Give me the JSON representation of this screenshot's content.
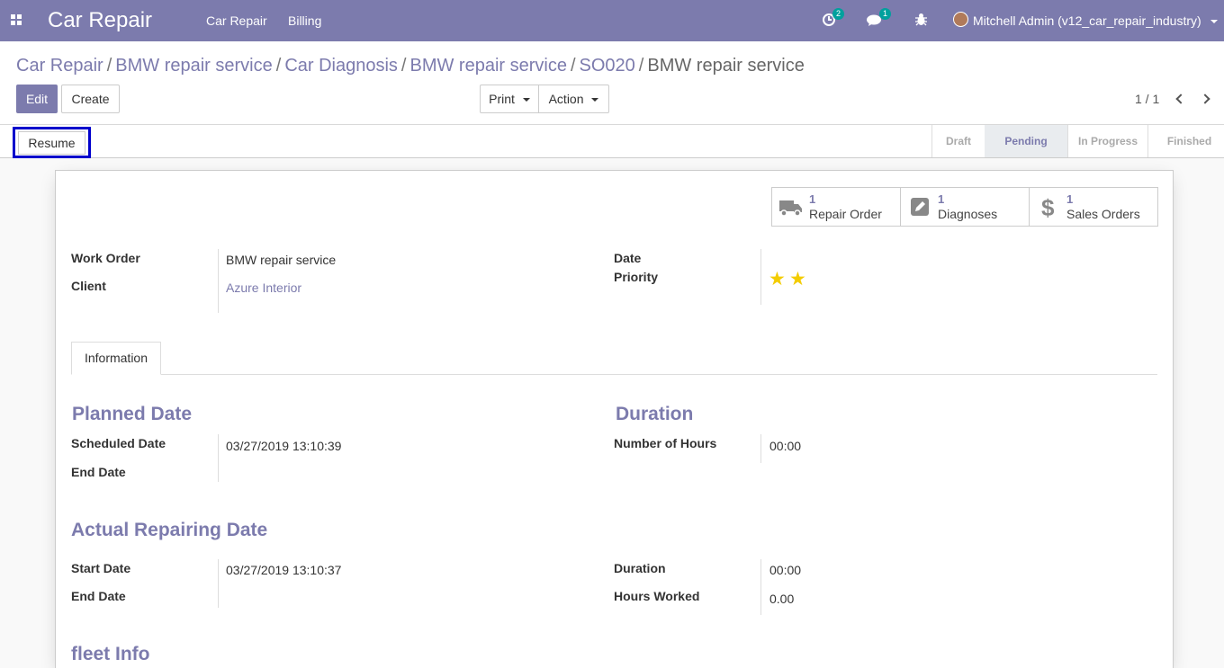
{
  "navbar": {
    "app_name": "Car Repair",
    "menu": [
      "Car Repair",
      "Billing"
    ],
    "activity_count": "2",
    "message_count": "1",
    "user": "Mitchell Admin (v12_car_repair_industry)"
  },
  "breadcrumb": {
    "items": [
      "Car Repair",
      "BMW repair service",
      "Car Diagnosis",
      "BMW repair service",
      "SO020"
    ],
    "separator": "/",
    "current": "BMW repair service"
  },
  "toolbar": {
    "edit": "Edit",
    "create": "Create",
    "print": "Print",
    "action": "Action",
    "pager": "1 / 1"
  },
  "statusbar": {
    "resume": "Resume",
    "stages": [
      "Draft",
      "Pending",
      "In Progress",
      "Finished"
    ],
    "active_stage": "Pending"
  },
  "smart_buttons": [
    {
      "count": "1",
      "label": "Repair Order",
      "icon": "truck-icon"
    },
    {
      "count": "1",
      "label": "Diagnoses",
      "icon": "pencil-square-icon"
    },
    {
      "count": "1",
      "label": "Sales Orders",
      "icon": "dollar-icon"
    }
  ],
  "header_fields": {
    "work_order_label": "Work Order",
    "work_order_value": "BMW repair service",
    "client_label": "Client",
    "client_value": "Azure Interior",
    "date_label": "Date",
    "priority_label": "Priority",
    "priority_stars": 2
  },
  "tabs": [
    "Information"
  ],
  "planned": {
    "title": "Planned Date",
    "scheduled_label": "Scheduled Date",
    "scheduled_value": "03/27/2019 13:10:39",
    "end_label": "End Date"
  },
  "duration": {
    "title": "Duration",
    "hours_label": "Number of Hours",
    "hours_value": "00:00"
  },
  "actual": {
    "title": "Actual Repairing Date",
    "start_label": "Start Date",
    "start_value": "03/27/2019 13:10:37",
    "end_label": "End Date",
    "duration_label": "Duration",
    "duration_value": "00:00",
    "worked_label": "Hours Worked",
    "worked_value": "0.00"
  },
  "fleet": {
    "title": "fleet Info"
  },
  "colors": {
    "brand": "#7c7bad",
    "badge": "#00a09d",
    "star": "#f3cc00",
    "highlight": "#0000cc"
  }
}
